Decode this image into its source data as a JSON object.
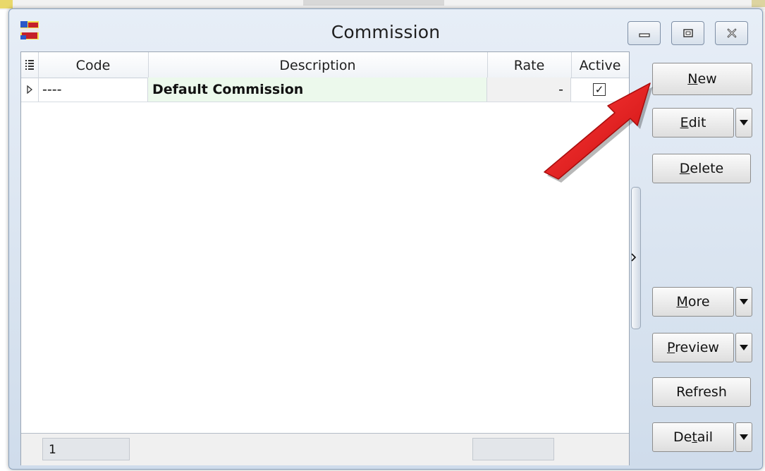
{
  "window": {
    "title": "Commission",
    "app_icon": "sql-account-app-icon",
    "caption_buttons": [
      "minimize-icon",
      "restore-icon",
      "close-icon"
    ]
  },
  "grid": {
    "columns": [
      "Code",
      "Description",
      "Rate",
      "Active"
    ],
    "rows": [
      {
        "code": "----",
        "description": "Default Commission",
        "rate": "-",
        "active": true,
        "active_mark": "✓"
      }
    ],
    "footer": {
      "record_count": "1"
    }
  },
  "buttons": {
    "new": {
      "pre": "",
      "accel": "N",
      "post": "ew"
    },
    "edit": {
      "pre": "",
      "accel": "E",
      "post": "dit"
    },
    "delete": {
      "pre": "",
      "accel": "D",
      "post": "elete"
    },
    "more": {
      "pre": "",
      "accel": "M",
      "post": "ore"
    },
    "preview": {
      "pre": "",
      "accel": "P",
      "post": "review"
    },
    "refresh": {
      "label": "Refresh"
    },
    "detail": {
      "pre": "De",
      "accel": "t",
      "post": "ail"
    }
  },
  "colors": {
    "annotation_arrow": "#e01c1c",
    "description_cell_bg": "#ecf9ec"
  }
}
